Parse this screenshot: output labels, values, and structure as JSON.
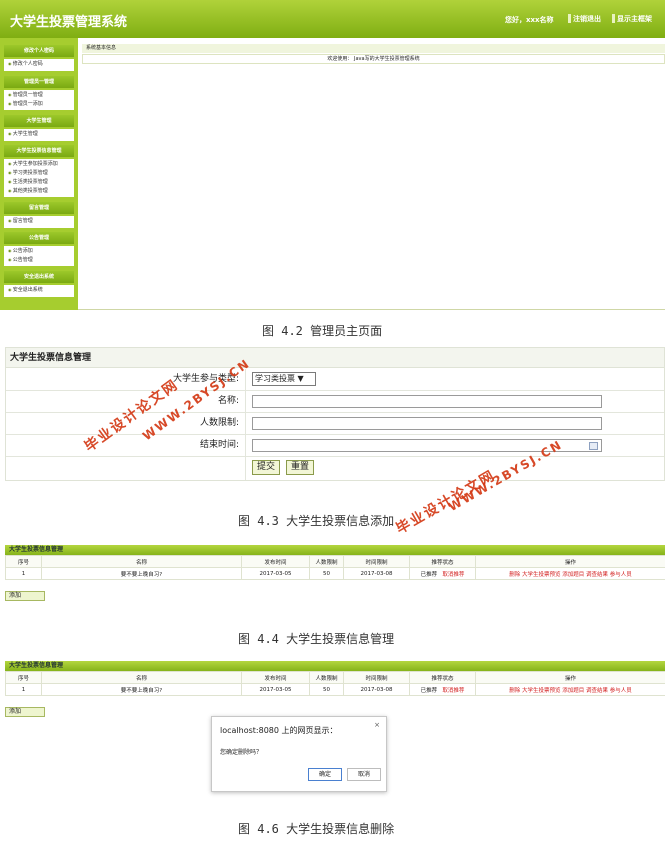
{
  "fig42": {
    "system_title": "大学生投票管理系统",
    "user_text": "您好，xxx名称",
    "logout": "注销退出",
    "show_menu": "显示主框架",
    "breadcrumb": "系统基本信息",
    "welcome": "欢迎使用： Java写的大学生投票管理系统",
    "menu_groups": [
      {
        "title": "修改个人密码",
        "items": [
          "修改个人密码"
        ]
      },
      {
        "title": "管理员一管理",
        "items": [
          "管理员一管理",
          "管理员一添加"
        ]
      },
      {
        "title": "大学生管理",
        "items": [
          "大学生管理"
        ]
      },
      {
        "title": "大学生投票信息管理",
        "items": [
          "大学生参加投票添加",
          "学习类投票管理",
          "生活类投票管理",
          "其他类投票管理"
        ]
      },
      {
        "title": "留言管理",
        "items": [
          "留言管理"
        ]
      },
      {
        "title": "公告管理",
        "items": [
          "公告添加",
          "公告管理"
        ]
      },
      {
        "title": "安全退出系统",
        "items": [
          "安全退出系统"
        ]
      }
    ],
    "caption": "图 4.2 管理员主页面"
  },
  "fig43": {
    "title": "大学生投票信息管理",
    "fields": [
      {
        "label": "大学生参与类型:",
        "value": "学习类投票 ▼"
      },
      {
        "label": "名称:",
        "value": ""
      },
      {
        "label": "人数限制:",
        "value": ""
      },
      {
        "label": "结束时间:",
        "value": ""
      }
    ],
    "submit": "提交",
    "reset": "重置",
    "caption": "图 4.3 大学生投票信息添加"
  },
  "fig44": {
    "title": "大学生投票信息管理",
    "headers": [
      "序号",
      "名称",
      "发布时间",
      "人数限制",
      "时间限制",
      "推荐状态",
      "操作"
    ],
    "row": {
      "no": "1",
      "name": "要不要上晚自习?",
      "publish": "2017-03-05",
      "limit": "50",
      "deadline": "2017-03-08",
      "status": "已推荐",
      "cancel": "取消推荐",
      "ops": "删除 大学生投票预览 添加题目 调查结果 参与人员"
    },
    "add": "添加",
    "caption": "图 4.4 大学生投票信息管理"
  },
  "fig46": {
    "title": "大学生投票信息管理",
    "headers": [
      "序号",
      "名称",
      "发布时间",
      "人数限制",
      "时间限制",
      "推荐状态",
      "操作"
    ],
    "row": {
      "no": "1",
      "name": "要不要上晚自习?",
      "publish": "2017-03-05",
      "limit": "50",
      "deadline": "2017-03-08",
      "status": "已推荐",
      "cancel": "取消推荐",
      "ops": "删除 大学生投票预览 添加题目 调查结果 参与人员"
    },
    "add": "添加",
    "dialog": {
      "title": "localhost:8080 上的网页显示：",
      "close": "×",
      "message": "您确定删除吗？",
      "ok": "确定",
      "cancel": "取消"
    },
    "caption": "图 4.6 大学生投票信息删除"
  },
  "watermark": {
    "text_cn": "毕业设计论文网",
    "text_url": "WWW.2BYSJ.CN",
    "color": "#d43a16"
  }
}
